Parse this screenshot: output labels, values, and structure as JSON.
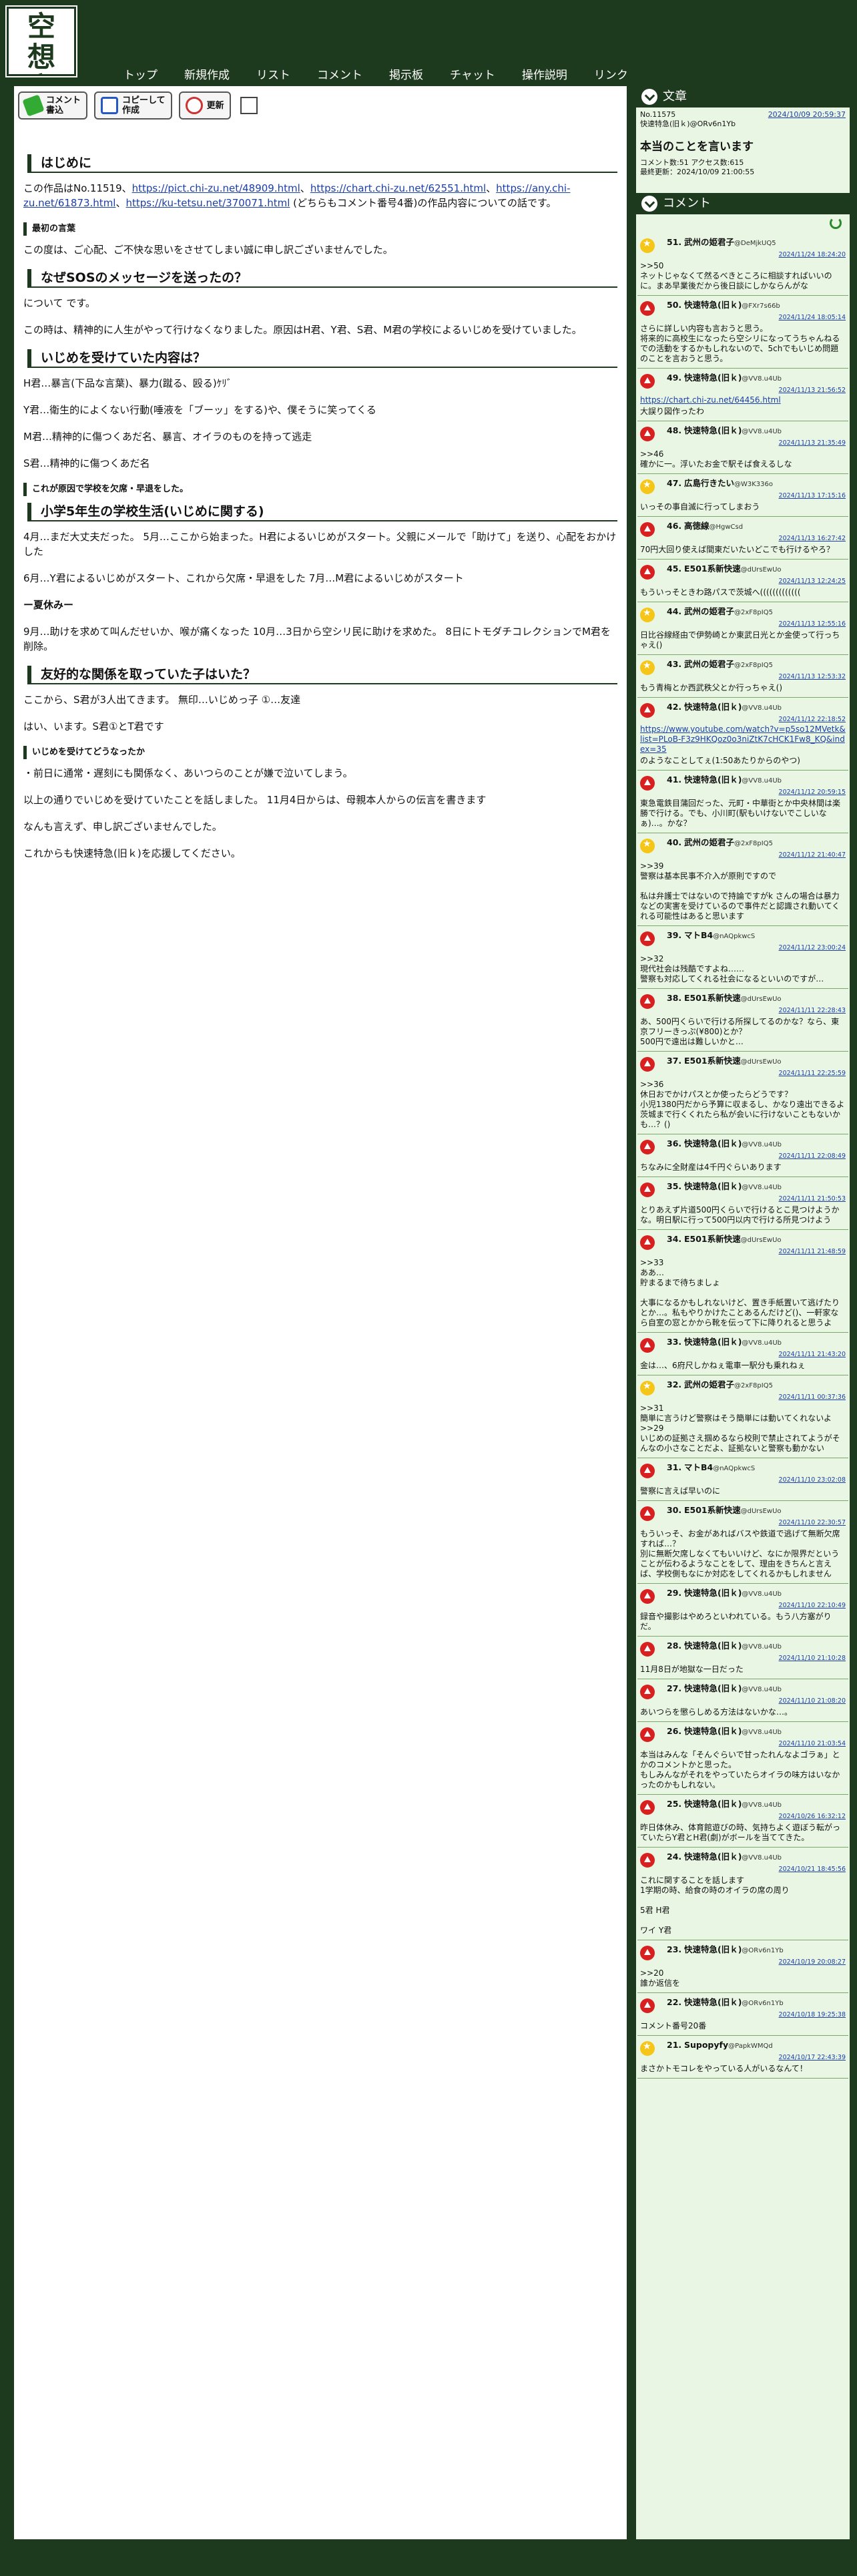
{
  "logo": [
    "空",
    "想",
    "文",
    "章"
  ],
  "nav": [
    "トップ",
    "新規作成",
    "リスト",
    "コメント",
    "掲示板",
    "チャット",
    "操作説明",
    "リンク"
  ],
  "toolbar": {
    "comment": "コメント\n書込",
    "copy": "コピーして\n作成",
    "refresh": "更新"
  },
  "article": {
    "h_intro": "はじめに",
    "intro_pre": "この作品はNo.11519、",
    "intro_link1": "https://pict.chi-zu.net/48909.html",
    "intro_link2": "https://chart.chi-zu.net/62551.html",
    "intro_link3": "https://any.chi-zu.net/61873.html",
    "intro_link4": "https://ku-tetsu.net/370071.html",
    "intro_post": "(どちらもコメント番号4番)の作品内容についての話です。",
    "h_apology": "最初の言葉",
    "apology": "この度は、ご心配、ご不快な思いをさせてしまい誠に申し訳ございませんでした。",
    "h_why": "なぜSOSのメッセージを送ったの？",
    "why1": "について です。",
    "why2": "この時は、精神的に人生がやって行けなくなりました。原因はH君、Y君、S君、M君の学校によるいじめを受けていました。",
    "h_content": "いじめを受けていた内容は？",
    "c1": "H君…暴言(下品な言葉)、暴力(蹴る、殴る)ｹﾘ゛",
    "c2": "Y君…衛生的によくない行動(唾液を「ブーッ」をする)や、僕そうに笑ってくる",
    "c3": "M君…精神的に傷つくあだ名、暴言、オイラのものを持って逃走",
    "c4": "S君…精神的に傷つくあだ名",
    "h_absent": "これが原因で学校を欠席・早退をした。",
    "h_grade5": "小学5年生の学校生活(いじめに関する)",
    "g1": "4月…まだ大丈夫だった。 5月…ここから始まった。H君によるいじめがスタート。父親にメールで「助けて」を送り、心配をおかけした",
    "g2": "6月…Y君によるいじめがスタート、これから欠席・早退をした 7月…M君によるいじめがスタート",
    "g_break": "ー夏休みー",
    "g3": "9月…助けを求めて叫んだせいか、喉が痛くなった 10月…3日から空シリ民に助けを求めた。 8日にトモダチコレクションでM君を削除。",
    "h_friends": "友好的な関係を取っていた子はいた？",
    "f1": "ここから、S君が3人出てきます。 無印…いじめっ子 ①…友達",
    "f2": "はい、います。S君①とT君です",
    "h_now": "いじめを受けてどうなったか",
    "n1": "・前日に通常・遅刻にも関係なく、あいつらのことが嫌で泣いてしまう。",
    "n2": "以上の通りでいじめを受けていたことを話しました。 11月4日からは、母親本人からの伝言を書きます",
    "n3": "なんも言えず、申し訳ございませんでした。",
    "n4": "これからも快速特急(旧ｋ)を応援してください。"
  },
  "side": {
    "work_bar": "文章",
    "no": "No.11575",
    "date": "2024/10/09 20:59:37",
    "author": "快速特急(旧ｋ)@ORv6n1Yb",
    "title": "本当のことを言います",
    "stats": "コメント数:51 アクセス数:615",
    "updated": "最終更新：2024/10/09 21:00:55",
    "comment_bar": "コメント"
  },
  "comments": [
    {
      "type": "star",
      "no": "51.",
      "name": "武州の姫君子",
      "id": "@DeMjkUQ5",
      "date": "2024/11/24 18:24:20",
      "body": ">>50\nネットじゃなくて然るべきところに相談すればいいのに。まあ早業後だから後日談にしかならんがな"
    },
    {
      "type": "up",
      "no": "50.",
      "name": "快速特急(旧ｋ)",
      "id": "@FXr7s66b",
      "date": "2024/11/24 18:05:14",
      "body": "さらに詳しい内容も言おうと思う。\n将来的に高校生になったら空シリになってうちゃんねるでの活動をするかもしれないので、5chでもいじめ問題のことを言おうと思う。"
    },
    {
      "type": "up",
      "no": "49.",
      "name": "快速特急(旧ｋ)",
      "id": "@VV8.u4Ub",
      "date": "2024/11/13 21:56:52",
      "link": "https://chart.chi-zu.net/64456.html",
      "body": "大誤り図作ったわ"
    },
    {
      "type": "up",
      "no": "48.",
      "name": "快速特急(旧ｋ)",
      "id": "@VV8.u4Ub",
      "date": "2024/11/13 21:35:49",
      "body": ">>46\n確かに一。浮いたお金で駅そば食えるしな"
    },
    {
      "type": "star",
      "no": "47.",
      "name": "広島行きたい",
      "id": "@W3K336o",
      "date": "2024/11/13 17:15:16",
      "body": "いっその事自滅に行ってしまおう"
    },
    {
      "type": "up",
      "no": "46.",
      "name": "高徳線",
      "id": "@HgwCsd",
      "date": "2024/11/13 16:27:42",
      "body": "70円大回り使えば間東だいたいどこでも行けるやろ？"
    },
    {
      "type": "up",
      "no": "45.",
      "name": "E501系新快速",
      "id": "@dUrsEwUo",
      "date": "2024/11/13 12:24:25",
      "body": "もういっそときわ路パスで茨城へ((((((((((((("
    },
    {
      "type": "star",
      "no": "44.",
      "name": "武州の姫君子",
      "id": "@2xF8pIQ5",
      "date": "2024/11/13 12:55:16",
      "body": "日比谷線経由で伊勢崎とか東武日光とか金使って行っちゃえ()"
    },
    {
      "type": "star",
      "no": "43.",
      "name": "武州の姫君子",
      "id": "@2xF8pIQ5",
      "date": "2024/11/13 12:53:32",
      "body": "もう青梅とか西武秩父とか行っちゃえ()"
    },
    {
      "type": "up",
      "no": "42.",
      "name": "快速特急(旧ｋ)",
      "id": "@VV8.u4Ub",
      "date": "2024/11/12 22:18:52",
      "link": "https://www.youtube.com/watch?v=p5so12MVetk&list=PLoB-F3z9HKQoz0o3niZtK7cHCK1Fw8_KQ&index=35",
      "body": "のようなことしてぇ(1:50あたりからのやつ)"
    },
    {
      "type": "up",
      "no": "41.",
      "name": "快速特急(旧ｋ)",
      "id": "@VV8.u4Ub",
      "date": "2024/11/12 20:59:15",
      "body": "東急電鉄目蒲回だった、元町・中華街とか中央林間は楽勝で行ける。でも、小川町(駅もいけないでこしいなぁ)…。かな？"
    },
    {
      "type": "star",
      "no": "40.",
      "name": "武州の姫君子",
      "id": "@2xF8pIQ5",
      "date": "2024/11/12 21:40:47",
      "body": ">>39\n警察は基本民事不介入が原則ですので\n\n私は弁護士ではないので持論ですがk さんの場合は暴力などの実害を受けているので事件だと認識され動いてくれる可能性はあると思います"
    },
    {
      "type": "up",
      "no": "39.",
      "name": "マトB4",
      "id": "@nAQpkwcS",
      "date": "2024/11/12 23:00:24",
      "body": ">>32\n現代社会は残酷ですよね……\n警察も対応してくれる社会になるといいのですが…"
    },
    {
      "type": "up",
      "no": "38.",
      "name": "E501系新快速",
      "id": "@dUrsEwUo",
      "date": "2024/11/11 22:28:43",
      "body": "あ、500円くらいで行ける所探してるのかな？なら、東京フリーきっぷ(¥800)とか？\n500円で遠出は難しいかと…"
    },
    {
      "type": "up",
      "no": "37.",
      "name": "E501系新快速",
      "id": "@dUrsEwUo",
      "date": "2024/11/11 22:25:59",
      "body": ">>36\n休日おでかけパスとか使ったらどうです？\n小児1380円だから予算に収まるし、かなり遠出できるよ\n茨城まで行くくれたら私が会いに行けないこともないかも…？()"
    },
    {
      "type": "up",
      "no": "36.",
      "name": "快速特急(旧ｋ)",
      "id": "@VV8.u4Ub",
      "date": "2024/11/11 22:08:49",
      "body": "ちなみに全財産は4千円ぐらいあります"
    },
    {
      "type": "up",
      "no": "35.",
      "name": "快速特急(旧ｋ)",
      "id": "@VV8.u4Ub",
      "date": "2024/11/11 21:50:53",
      "body": "とりあえず片道500円くらいで行けるとこ見つけようかな。明日駅に行って500円以内で行ける所見つけよう"
    },
    {
      "type": "up",
      "no": "34.",
      "name": "E501系新快速",
      "id": "@dUrsEwUo",
      "date": "2024/11/11 21:48:59",
      "body": ">>33\nああ…\n貯まるまで待ちましょ\n\n大事になるかもしれないけど、置き手紙置いて逃げたりとか…。私もやりかけたことあるんだけど()、一軒家なら自室の窓とかから靴を伝って下に降りれると思うよ"
    },
    {
      "type": "up",
      "no": "33.",
      "name": "快速特急(旧ｋ)",
      "id": "@VV8.u4Ub",
      "date": "2024/11/11 21:43:20",
      "body": "金は…、6府尺しかねぇ電車一駅分も乗れねぇ"
    },
    {
      "type": "star",
      "no": "32.",
      "name": "武州の姫君子",
      "id": "@2xF8pIQ5",
      "date": "2024/11/11 00:37:36",
      "body": ">>31\n簡単に言うけど警察はそう簡単には動いてくれないよ\n>>29\nいじめの証拠さえ掴めるなら校則で禁止されてようがそんなの小さなことだよ、証拠ないと警察も動かない"
    },
    {
      "type": "up",
      "no": "31.",
      "name": "マトB4",
      "id": "@nAQpkwcS",
      "date": "2024/11/10 23:02:08",
      "body": "警察に言えば早いのに"
    },
    {
      "type": "up",
      "no": "30.",
      "name": "E501系新快速",
      "id": "@dUrsEwUo",
      "date": "2024/11/10 22:30:57",
      "body": "もういっそ、お金があればバスや鉄道で逃げて無断欠席すれば…？\n別に無断欠席しなくてもいいけど、なにか限界だということが伝わるようなことをして、理由をきちんと言えば、学校側もなにか対応をしてくれるかもしれません"
    },
    {
      "type": "up",
      "no": "29.",
      "name": "快速特急(旧ｋ)",
      "id": "@VV8.u4Ub",
      "date": "2024/11/10 22:10:49",
      "body": "録音や撮影はやめろといわれている。もう八方塞がりだ。"
    },
    {
      "type": "up",
      "no": "28.",
      "name": "快速特急(旧ｋ)",
      "id": "@VV8.u4Ub",
      "date": "2024/11/10 21:10:28",
      "body": "11月8日が地獄な一日だった"
    },
    {
      "type": "up",
      "no": "27.",
      "name": "快速特急(旧ｋ)",
      "id": "@VV8.u4Ub",
      "date": "2024/11/10 21:08:20",
      "body": "あいつらを懲らしめる方法はないかな…。"
    },
    {
      "type": "up",
      "no": "26.",
      "name": "快速特急(旧ｋ)",
      "id": "@VV8.u4Ub",
      "date": "2024/11/10 21:03:54",
      "body": "本当はみんな「そんぐらいで甘ったれんなよゴラぁ」とかのコメントかと思った。\nもしみんながそれをやっていたらオイラの味方はいなかったのかもしれない。"
    },
    {
      "type": "up",
      "no": "25.",
      "name": "快速特急(旧ｋ)",
      "id": "@VV8.u4Ub",
      "date": "2024/10/26 16:32:12",
      "body": "昨日体休み、体育館遊びの時、気持ちよく遊ぼう転がっていたらY君とH君(劇)がボールを当ててきた。"
    },
    {
      "type": "up",
      "no": "24.",
      "name": "快速特急(旧ｋ)",
      "id": "@VV8.u4Ub",
      "date": "2024/10/21 18:45:56",
      "body": "これに関することを話します\n1学期の時、給食の時のオイラの席の周り\n\n5君 H君\n\nワイ Y君"
    },
    {
      "type": "up",
      "no": "23.",
      "name": "快速特急(旧ｋ)",
      "id": "@ORv6n1Yb",
      "date": "2024/10/19 20:08:27",
      "body": ">>20\n誰か返信を"
    },
    {
      "type": "up",
      "no": "22.",
      "name": "快速特急(旧ｋ)",
      "id": "@ORv6n1Yb",
      "date": "2024/10/18 19:25:38",
      "body": "コメント番号20番"
    },
    {
      "type": "star",
      "no": "21.",
      "name": "Supopyfy",
      "id": "@PapkWMQd",
      "date": "2024/10/17 22:43:39",
      "body": "まさかトモコレをやっている人がいるなんて！"
    }
  ]
}
